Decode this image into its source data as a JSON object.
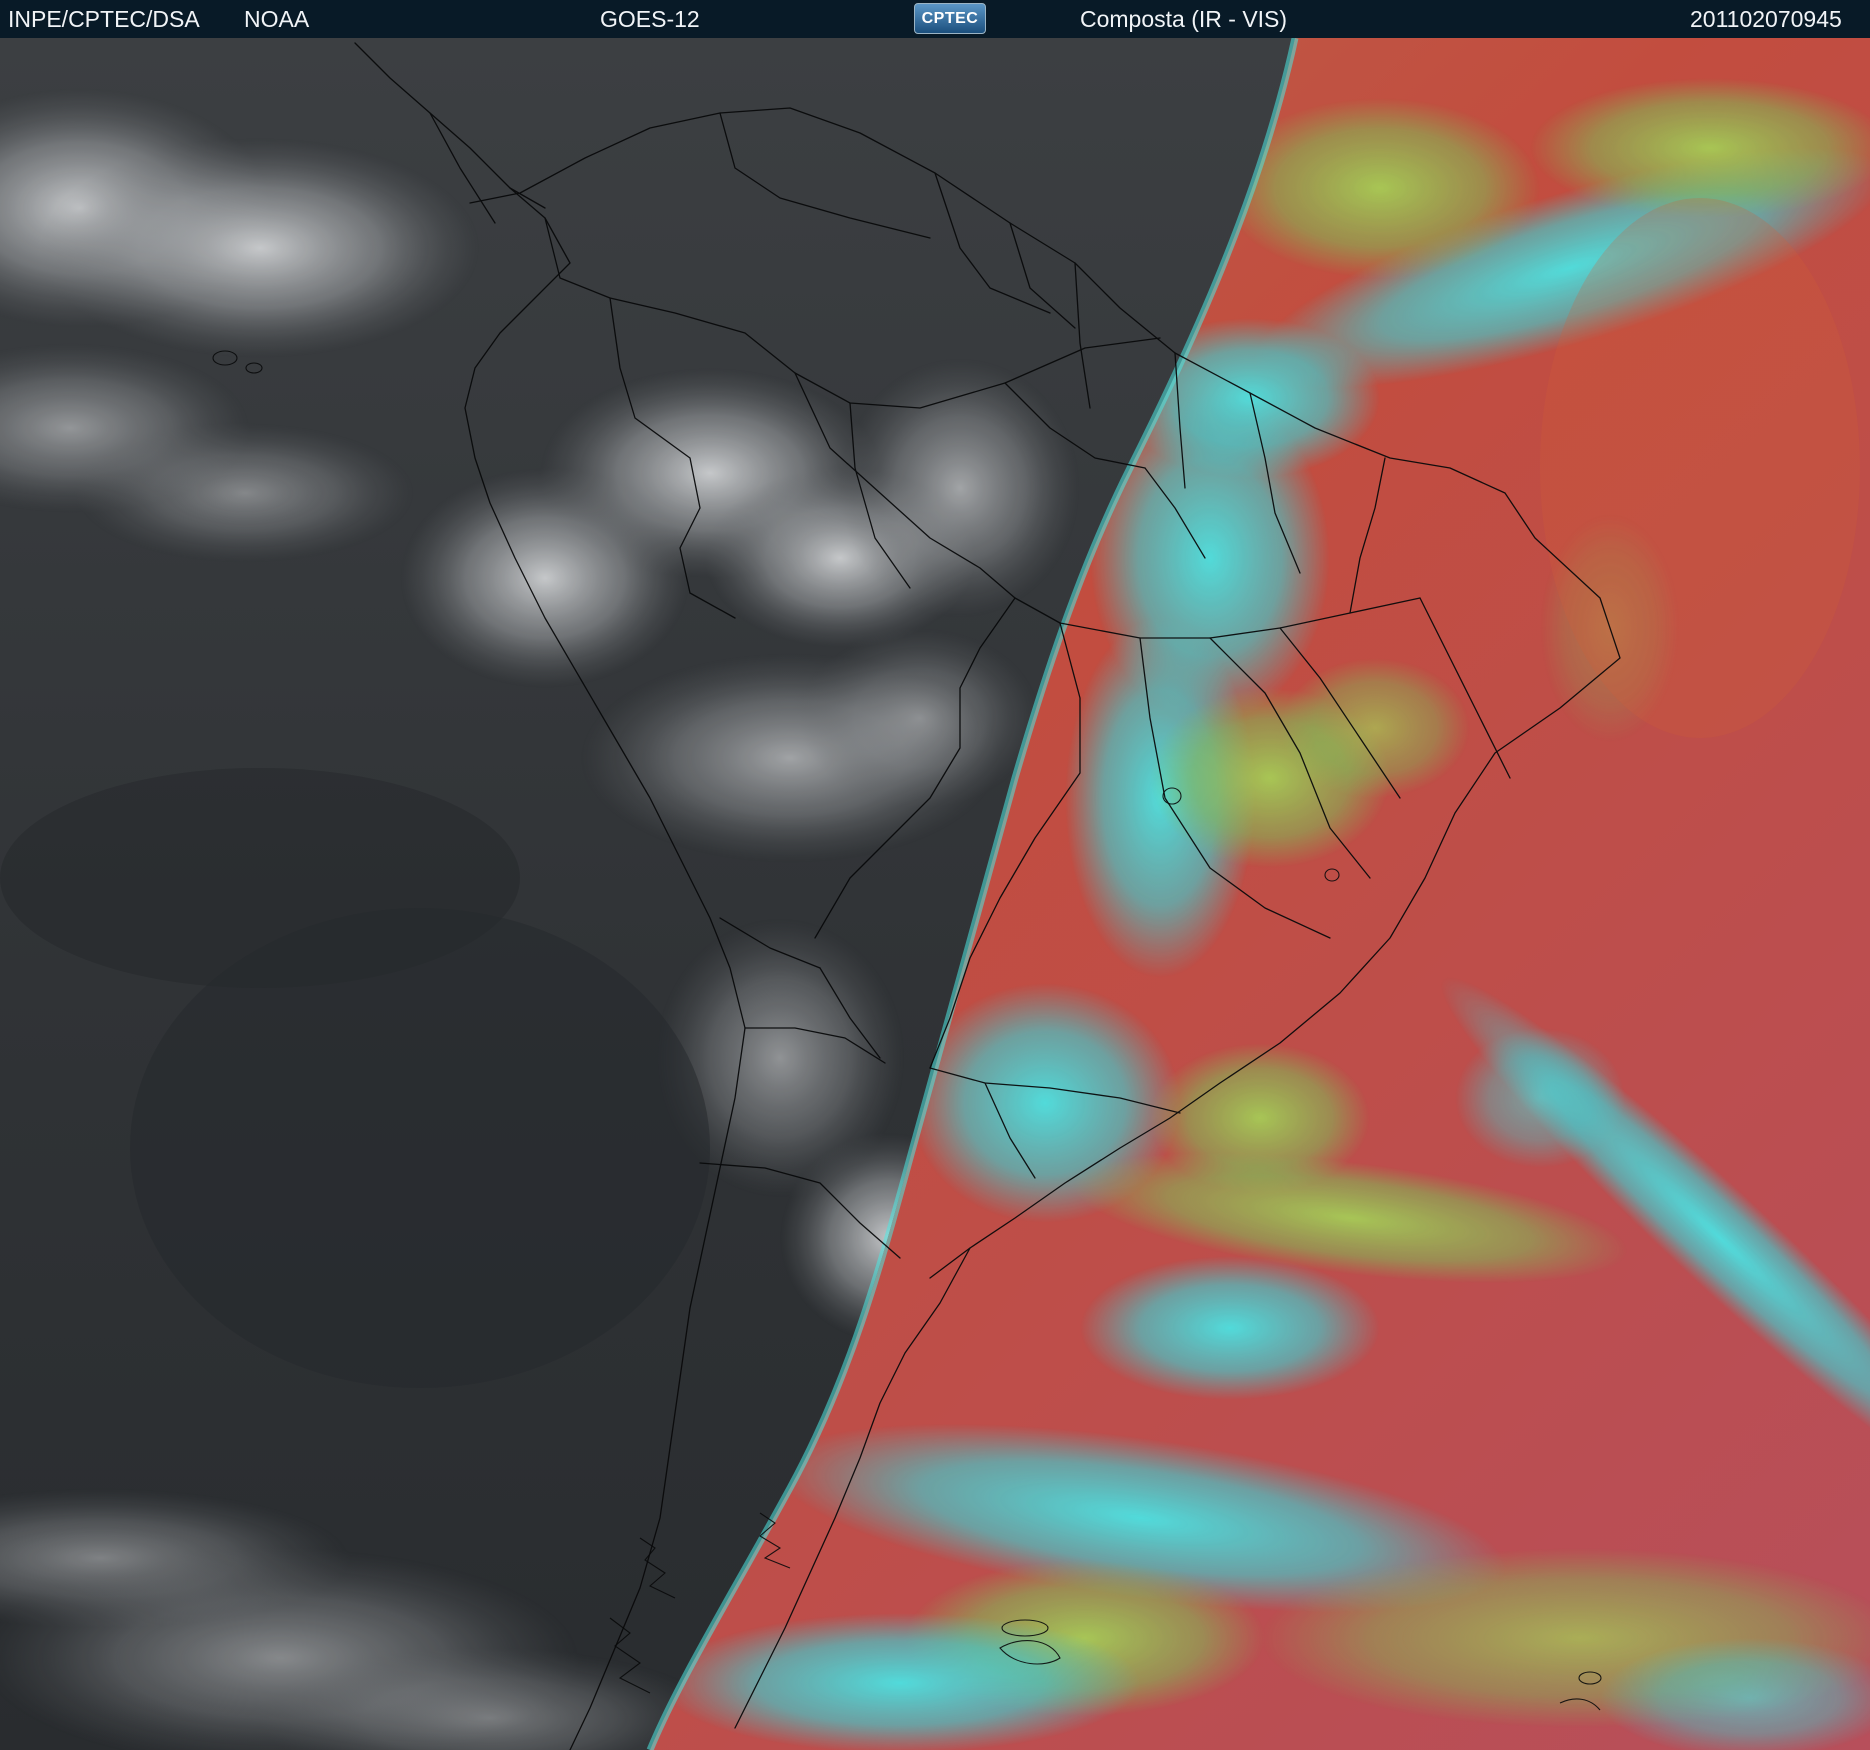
{
  "header": {
    "agency": "INPE/CPTEC/DSA",
    "source": "NOAA",
    "satellite": "GOES-12",
    "logo_text": "CPTEC",
    "product": "Composta (IR - VIS)",
    "timestamp": "201102070945"
  },
  "colors": {
    "header_bg": "#081a27",
    "header_text": "#f1f4f7",
    "ir_night": "#2b2e31",
    "ir_cloud": "#bfc2c5",
    "vis_ocean": "#c44a3b",
    "vis_cloud_cyan": "#35e0e2",
    "vis_cloud_green": "#8ad45b",
    "vis_land": "#b85b45",
    "borders": "#111111"
  },
  "icons": {
    "logo": "cptec-logo"
  }
}
